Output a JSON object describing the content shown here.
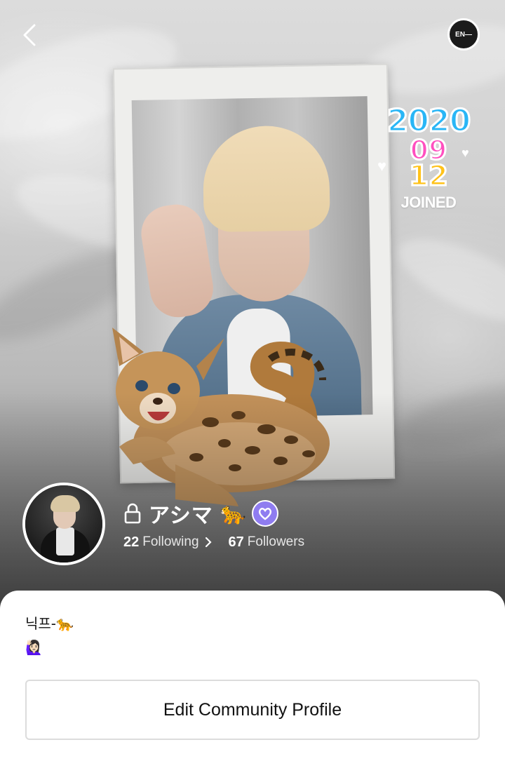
{
  "header": {
    "back_icon": "chevron-left-icon",
    "community_badge": "EN—"
  },
  "cover": {
    "joined_sticker": {
      "year": "2020",
      "month": "09",
      "day": "12",
      "label": "JOINED",
      "colors": {
        "year": "#29b6f6",
        "month": "#ff4fbf",
        "day": "#ffc21a"
      }
    },
    "sticker_icon": "cheetah-cub-icon",
    "photo": "polaroid-photo"
  },
  "profile": {
    "lock_icon": "lock-icon",
    "nickname": "アシマ",
    "name_emoji": "🐆",
    "verified_icon": "verified-badge-icon",
    "verified_color": "#8f7cf0",
    "following_count": "22",
    "following_label": "Following",
    "followers_count": "67",
    "followers_label": "Followers"
  },
  "bio": {
    "line1": "닉프-🐆",
    "line2": "🙋🏻‍♀️"
  },
  "actions": {
    "edit_profile_label": "Edit Community Profile"
  }
}
